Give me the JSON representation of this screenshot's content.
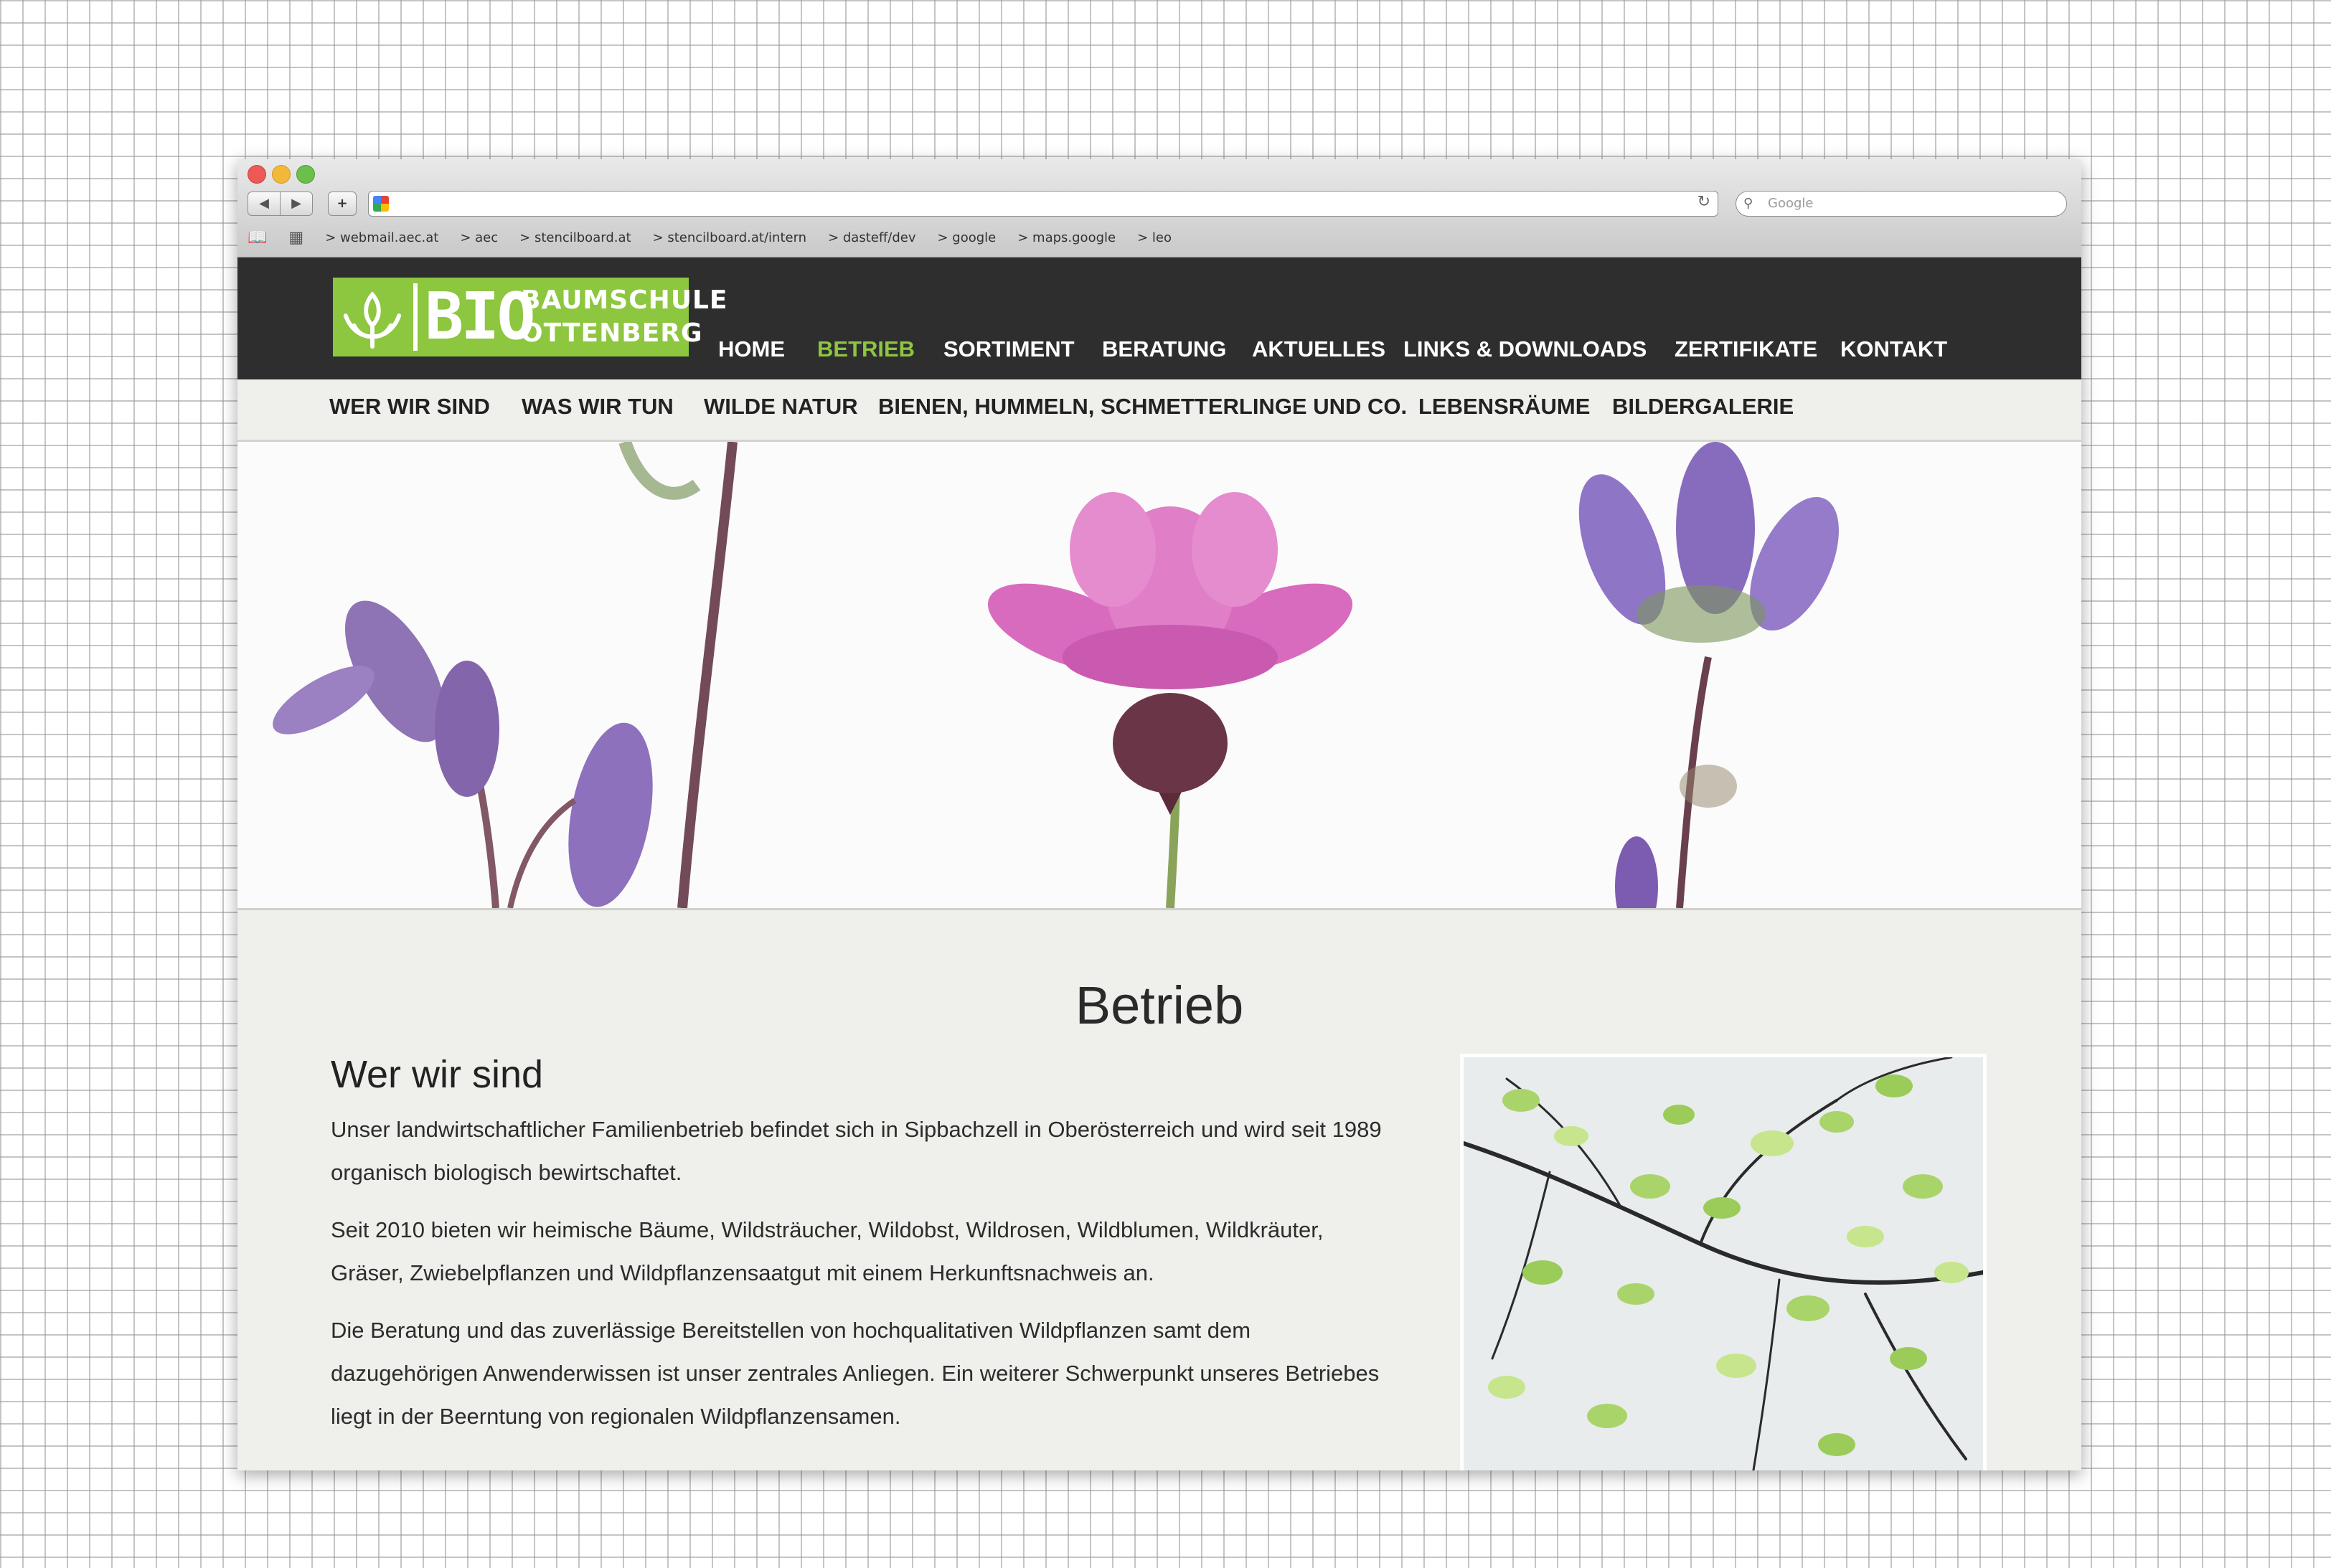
{
  "browser": {
    "nav": {
      "back": "◀",
      "forward": "▶",
      "add": "+"
    },
    "search_placeholder": "Google",
    "bookmarks": [
      "> webmail.aec.at",
      "> aec",
      "> stencilboard.at",
      "> stencilboard.at/intern",
      "> dasteff/dev",
      "> google",
      "> maps.google",
      "> leo"
    ]
  },
  "logo": {
    "bio": "BIO",
    "line1": "BAUMSCHULE",
    "line2": "OTTENBERG"
  },
  "main_nav": [
    "HOME",
    "BETRIEB",
    "SORTIMENT",
    "BERATUNG",
    "AKTUELLES",
    "LINKS & DOWNLOADS",
    "ZERTIFIKATE",
    "KONTAKT"
  ],
  "main_nav_active": "BETRIEB",
  "sub_nav": [
    "WER WIR SIND",
    "WAS WIR TUN",
    "WILDE NATUR",
    "BIENEN, HUMMELN, SCHMETTERLINGE UND CO.",
    "LEBENSRÄUME",
    "BILDERGALERIE"
  ],
  "content": {
    "page_title": "Betrieb",
    "section_title": "Wer wir sind",
    "paragraphs": [
      "Unser landwirtschaftlicher Familienbetrieb befindet sich in Sipbachzell in Oberösterreich und wird seit 1989 organisch biologisch bewirtschaftet.",
      "Seit 2010 bieten wir heimische Bäume, Wildsträucher, Wildobst, Wildrosen, Wildblumen, Wildkräuter, Gräser, Zwiebelpflanzen und Wildpflanzensaatgut mit einem Herkunftsnachweis an.",
      "Die Beratung und das zuverlässige Bereitstellen von hochqualitativen Wildpflanzen samt dem dazugehörigen Anwenderwissen ist unser zentrales Anliegen. Ein weiterer Schwerpunkt unseres Betriebes liegt in der Beerntung von regionalen Wildpflanzensamen."
    ]
  },
  "colors": {
    "brand_green": "#8dc63f",
    "header_dark": "#2e2e2e",
    "content_bg": "#efefeb"
  },
  "icons": [
    "close-window-icon",
    "minimize-window-icon",
    "zoom-window-icon",
    "reload-icon",
    "search-icon",
    "bookmarks-book-icon",
    "top-sites-grid-icon",
    "logo-plant-icon"
  ]
}
